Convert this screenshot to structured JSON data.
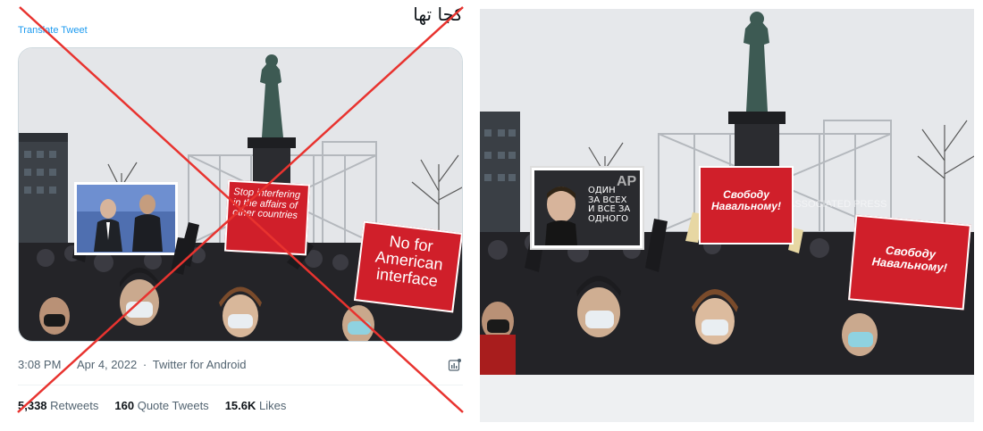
{
  "tweet": {
    "text": "کجا تها",
    "translate_label": "Translate Tweet",
    "time": "3:08 PM",
    "date": "Apr 4, 2022",
    "source": "Twitter for Android",
    "retweets_count": "5,338",
    "retweets_label": "Retweets",
    "quotes_count": "160",
    "quotes_label": "Quote Tweets",
    "likes_count": "15.6K",
    "likes_label": "Likes"
  },
  "manipulated_photo": {
    "inset_signs": {
      "sign1": "Stop interfering in the affairs of other countries",
      "sign2_line1": "No for",
      "sign2_line2": "American",
      "sign2_line3": "interface"
    }
  },
  "original_photo": {
    "watermark": "ASSOCIATED PRESS",
    "ap_logo": "AP",
    "sign_portrait_line1": "ОДИН",
    "sign_portrait_line2": "ЗА ВСЕХ",
    "sign_portrait_line3": "И ВСЕ ЗА",
    "sign_portrait_line4": "ОДНОГО",
    "sign_red1_line1": "Свободу",
    "sign_red1_line2": "Навальному!",
    "sign_red2_line1": "Свободу",
    "sign_red2_line2": "Навальному!"
  },
  "colors": {
    "cross": "#e8332f",
    "sign_red": "#d01f2a",
    "link_blue": "#1d9bf0"
  }
}
